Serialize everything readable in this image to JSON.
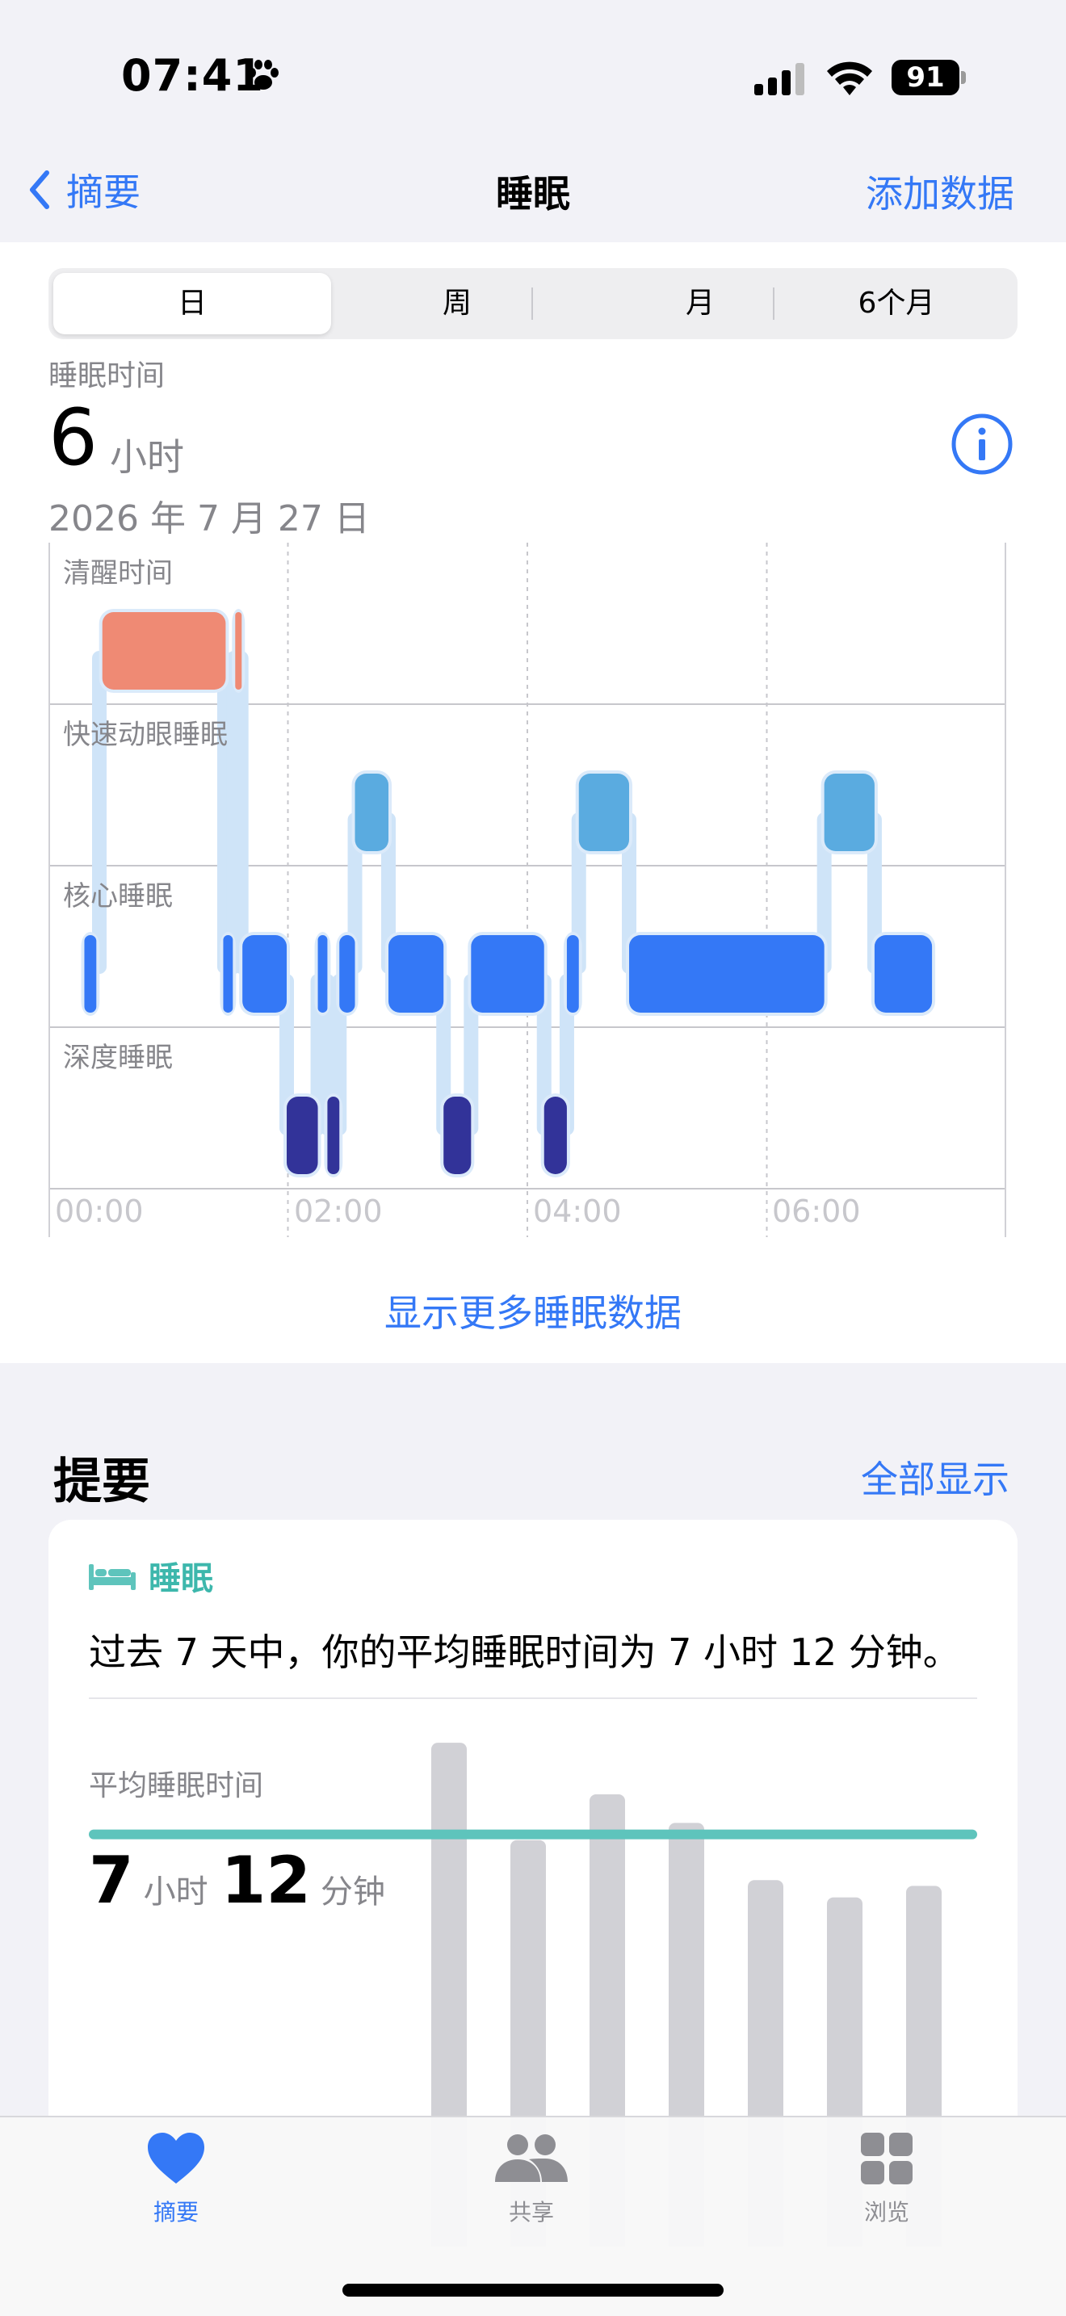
{
  "status": {
    "time": "07:41",
    "battery": "91"
  },
  "nav": {
    "back_label": "摘要",
    "title": "睡眠",
    "action_label": "添加数据"
  },
  "segments": [
    "日",
    "周",
    "月",
    "6个月"
  ],
  "selected_segment": "日",
  "metric": {
    "label": "睡眠时间",
    "value": "6",
    "unit": "小时",
    "date": "2026 年 7 月 27 日"
  },
  "chart_data": {
    "type": "sleep-stages",
    "stage_labels": [
      "清醒时间",
      "快速动眼睡眠",
      "核心睡眠",
      "深度睡眠"
    ],
    "x_ticks": [
      "00:00",
      "02:00",
      "04:00",
      "06:00"
    ],
    "x_range_hours": [
      0,
      8
    ],
    "colors": {
      "awake": "#ef8a74",
      "rem": "#5aabe0",
      "core": "#3478f6",
      "deep": "#323399"
    },
    "segments": [
      {
        "stage": "core",
        "start": 0.3,
        "end": 0.4
      },
      {
        "stage": "awake",
        "start": 0.45,
        "end": 1.48
      },
      {
        "stage": "awake",
        "start": 1.56,
        "end": 1.6
      },
      {
        "stage": "core",
        "start": 1.46,
        "end": 1.54
      },
      {
        "stage": "core",
        "start": 1.62,
        "end": 1.99
      },
      {
        "stage": "deep",
        "start": 1.99,
        "end": 2.25
      },
      {
        "stage": "core",
        "start": 2.25,
        "end": 2.33
      },
      {
        "stage": "deep",
        "start": 2.33,
        "end": 2.43
      },
      {
        "stage": "core",
        "start": 2.43,
        "end": 2.56
      },
      {
        "stage": "rem",
        "start": 2.56,
        "end": 2.84
      },
      {
        "stage": "core",
        "start": 2.84,
        "end": 3.3
      },
      {
        "stage": "deep",
        "start": 3.3,
        "end": 3.53
      },
      {
        "stage": "core",
        "start": 3.53,
        "end": 4.14
      },
      {
        "stage": "deep",
        "start": 4.14,
        "end": 4.33
      },
      {
        "stage": "core",
        "start": 4.33,
        "end": 4.43
      },
      {
        "stage": "rem",
        "start": 4.43,
        "end": 4.85
      },
      {
        "stage": "core",
        "start": 4.85,
        "end": 6.48
      },
      {
        "stage": "rem",
        "start": 6.48,
        "end": 6.9
      },
      {
        "stage": "core",
        "start": 6.9,
        "end": 7.38
      }
    ]
  },
  "more_link": "显示更多睡眠数据",
  "summary": {
    "title": "提要",
    "show_all": "全部显示",
    "card": {
      "category": "睡眠",
      "text": "过去 7 天中，你的平均睡眠时间为 7 小时 12 分钟。",
      "avg_label": "平均睡眠时间",
      "avg_hours": "7",
      "hours_unit": "小时",
      "avg_minutes": "12",
      "minutes_unit": "分钟",
      "accent": "#5ec4bc",
      "bar_color": "#d1d1d6"
    },
    "week_chart": {
      "type": "bar",
      "values": [
        8.8,
        7.1,
        7.9,
        7.4,
        6.4,
        6.1,
        6.3
      ],
      "average": 7.2,
      "y_min": 0,
      "y_max": 9
    }
  },
  "tabs": [
    {
      "label": "摘要",
      "icon": "heart-icon",
      "active": true
    },
    {
      "label": "共享",
      "icon": "people-icon",
      "active": false
    },
    {
      "label": "浏览",
      "icon": "grid-icon",
      "active": false
    }
  ]
}
